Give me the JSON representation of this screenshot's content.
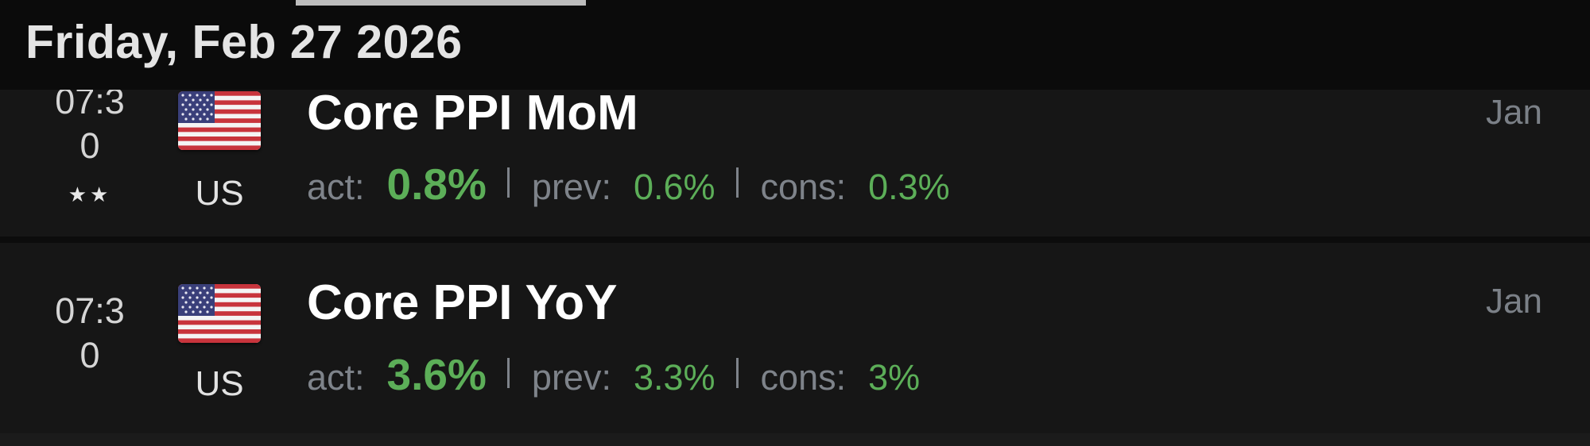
{
  "header": {
    "date": "Friday, Feb 27 2026"
  },
  "events": [
    {
      "time_line1": "07:3",
      "time_line2": "0",
      "stars": "★★",
      "importance_stars": 2,
      "flag_icon": "us-flag-icon",
      "country": "US",
      "title": "Core PPI MoM",
      "period": "Jan",
      "act_label": "act:",
      "actual": "0.8%",
      "prev_label": "prev:",
      "previous": "0.6%",
      "cons_label": "cons:",
      "consensus": "0.3%"
    },
    {
      "time_line1": "07:3",
      "time_line2": "0",
      "stars": "",
      "importance_stars": 0,
      "flag_icon": "us-flag-icon",
      "country": "US",
      "title": "Core PPI YoY",
      "period": "Jan",
      "act_label": "act:",
      "actual": "3.6%",
      "prev_label": "prev:",
      "previous": "3.3%",
      "cons_label": "cons:",
      "consensus": "3%"
    }
  ],
  "colors": {
    "positive_value": "#5cae58",
    "label_gray": "#7e838a",
    "background": "#131313"
  }
}
